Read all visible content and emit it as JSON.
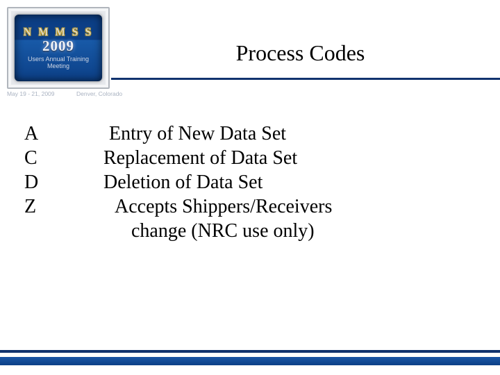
{
  "header": {
    "logo": {
      "acronym": "N M M S S",
      "year": "2009",
      "sub": "Users Annual\nTraining Meeting"
    },
    "date": "May 19 - 21, 2009",
    "location": "Denver, Colorado",
    "title": "Process Codes"
  },
  "codes": [
    {
      "code": "A",
      "desc": "Entry of New Data Set"
    },
    {
      "code": "C",
      "desc": "Replacement of Data Set"
    },
    {
      "code": "D",
      "desc": "Deletion of Data Set"
    },
    {
      "code": "Z",
      "desc_l1": "Accepts Shippers/Receivers",
      "desc_l2": "change  (NRC use only)"
    }
  ]
}
